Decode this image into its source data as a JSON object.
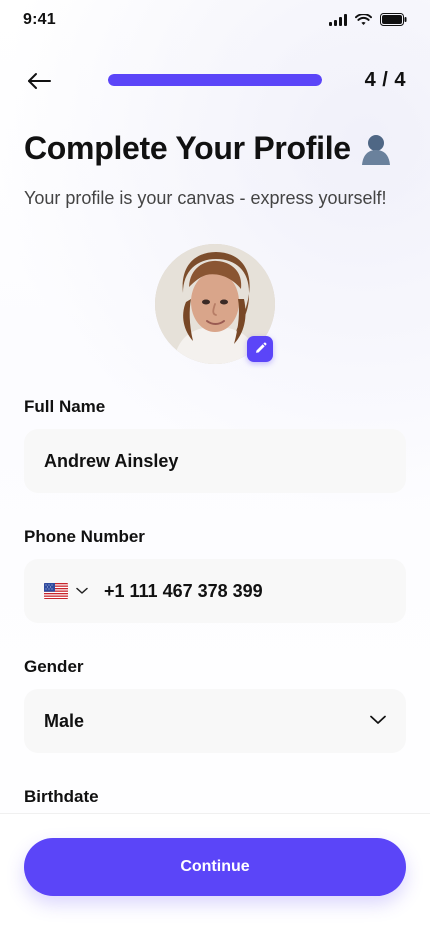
{
  "status_bar": {
    "time": "9:41",
    "icons": [
      "signal-icon",
      "wifi-icon",
      "battery-icon"
    ]
  },
  "header": {
    "back_icon": "arrow-left-icon",
    "progress": 1.0,
    "step_label": "4 / 4",
    "accent_color": "#5b45f8"
  },
  "page": {
    "title": "Complete Your Profile",
    "title_emoji": "👤",
    "subtitle": "Your profile is your canvas - express yourself!"
  },
  "avatar": {
    "edit_icon": "pencil-icon"
  },
  "form": {
    "full_name": {
      "label": "Full Name",
      "value": "Andrew Ainsley"
    },
    "phone": {
      "label": "Phone Number",
      "country_flag": "us-flag-icon",
      "chevron_icon": "chevron-down-icon",
      "value": "+1 111 467 378 399"
    },
    "gender": {
      "label": "Gender",
      "value": "Male",
      "chevron_icon": "chevron-down-icon"
    },
    "birthdate": {
      "label": "Birthdate"
    }
  },
  "footer": {
    "continue_label": "Continue"
  },
  "colors": {
    "accent": "#5b45f8",
    "field_background": "#f8f8f8",
    "text": "#111111",
    "secondary_text": "#444444"
  }
}
